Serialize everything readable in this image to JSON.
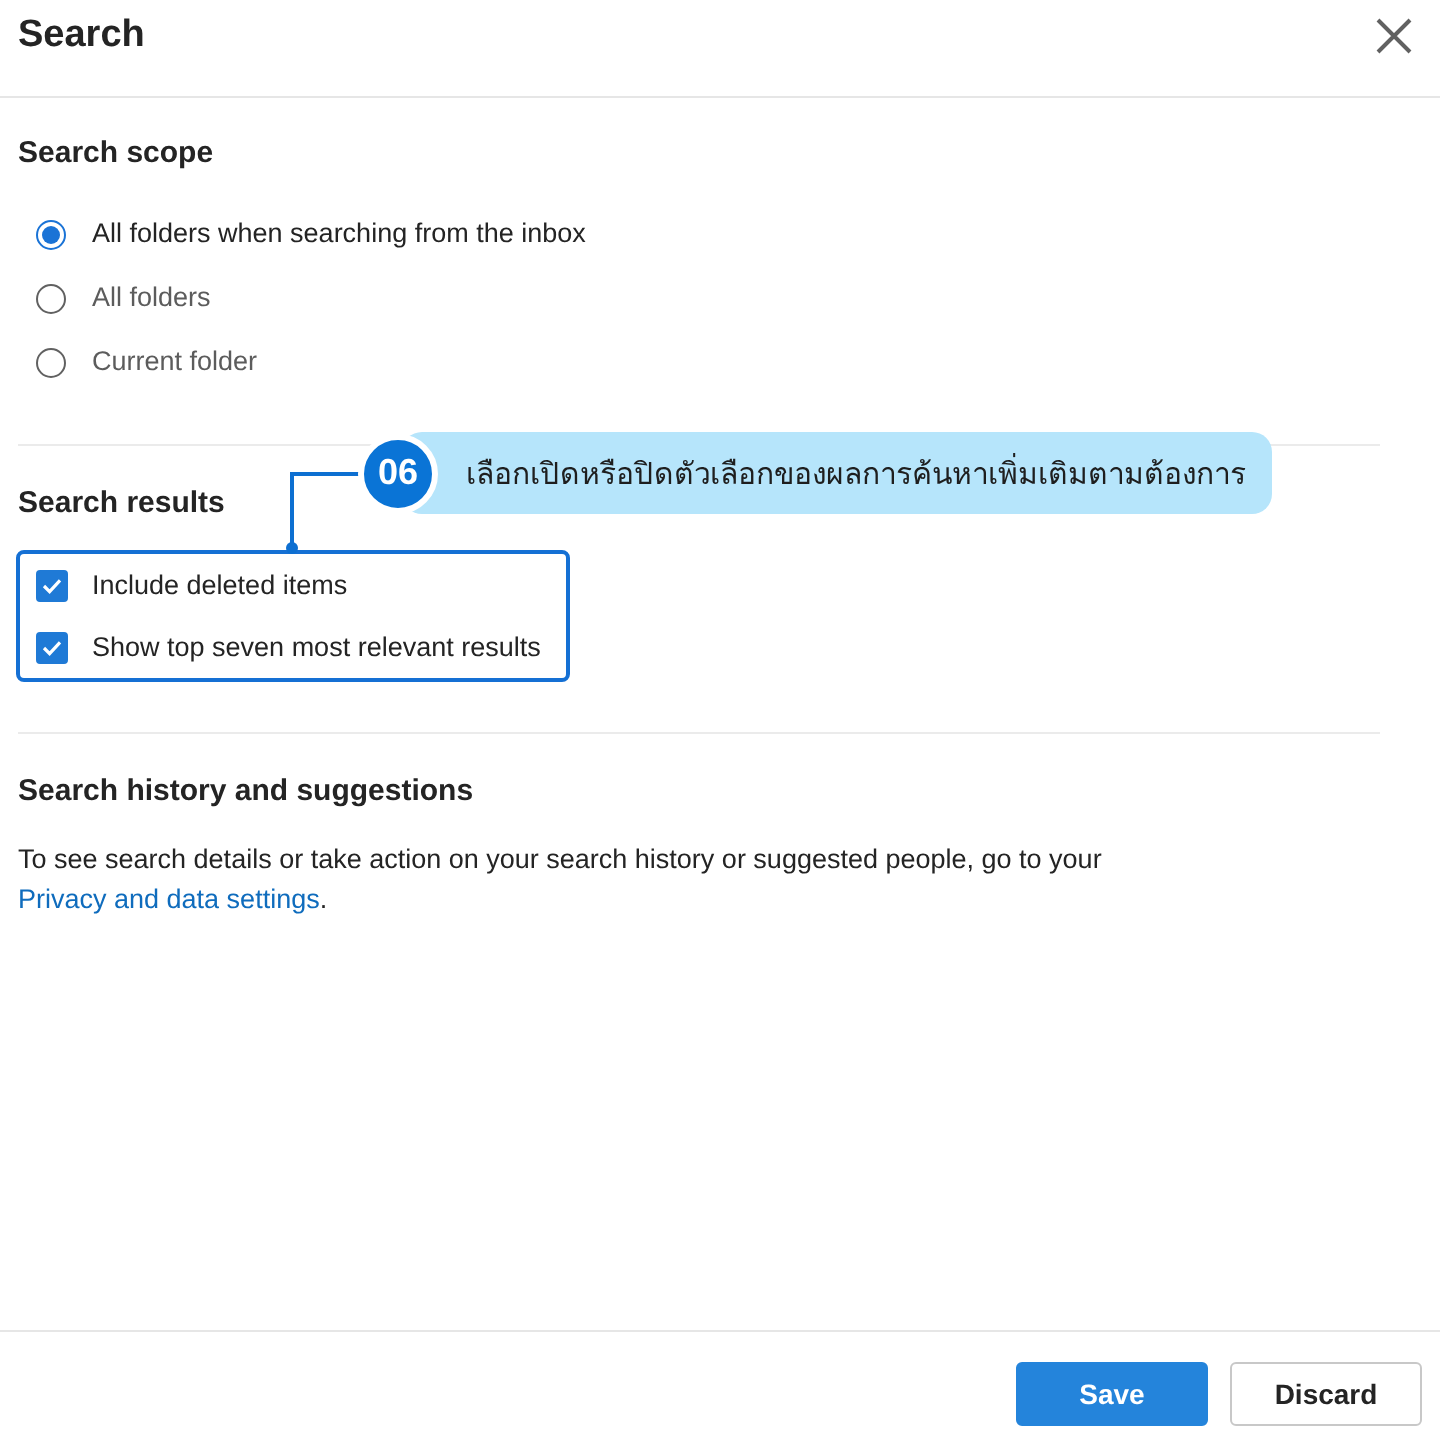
{
  "dialog": {
    "title": "Search"
  },
  "sections": [
    {
      "kind": "radio",
      "heading": "Search scope",
      "options": [
        {
          "label": "All folders when searching from the inbox",
          "selected": true
        },
        {
          "label": "All folders",
          "selected": false
        },
        {
          "label": "Current folder",
          "selected": false
        }
      ]
    },
    {
      "kind": "checkbox",
      "heading": "Search results",
      "highlighted": true,
      "options": [
        {
          "label": "Include deleted items",
          "checked": true
        },
        {
          "label": "Show top seven most relevant results",
          "checked": true
        }
      ]
    },
    {
      "kind": "text",
      "heading": "Search history and suggestions",
      "text": "To see search details or take action on your search history or suggested people, go to your",
      "link": "Privacy and data settings",
      "link_suffix": "."
    }
  ],
  "annotation": {
    "number": "06",
    "text": "เลือกเปิดหรือปิดตัวเลือกของผลการค้นหาเพิ่มเติมตามต้องการ"
  },
  "buttons": [
    {
      "label": "Save",
      "kind": "primary"
    },
    {
      "label": "Discard",
      "kind": "secondary"
    }
  ]
}
